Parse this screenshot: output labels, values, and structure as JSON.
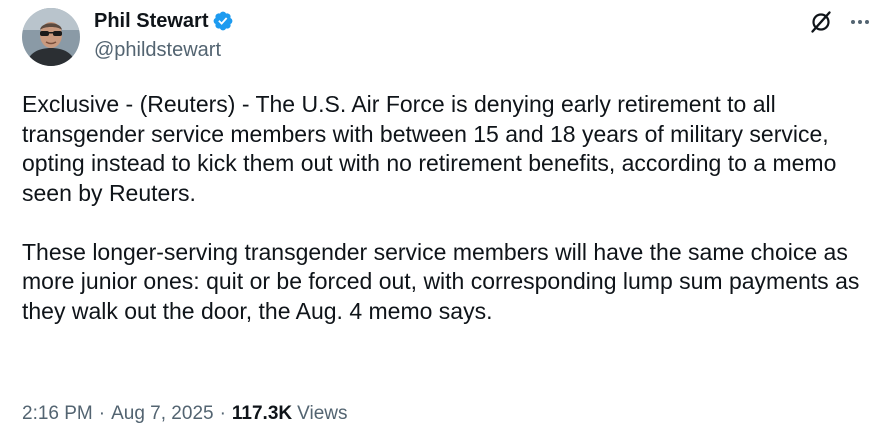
{
  "author": {
    "display_name": "Phil Stewart",
    "handle": "@phildstewart",
    "verified": true,
    "verified_color": "#1d9bf0"
  },
  "tweet": {
    "paragraphs": [
      "Exclusive - (Reuters) - The U.S. Air Force is denying early retirement to all transgender service members with between 15 and 18 years of military service, opting instead to kick them out with no retirement benefits, according to a memo seen by Reuters.",
      "These longer-serving transgender service members will have the same choice as more junior ones: quit or be forced out, with corresponding lump sum payments as they walk out the door, the Aug. 4 memo says."
    ]
  },
  "meta": {
    "time": "2:16 PM",
    "separator": "·",
    "date": "Aug 7, 2025",
    "views_count": "117.3K",
    "views_label": "Views"
  },
  "icons": {
    "grok": "grok-icon",
    "more": "more-options-icon",
    "verified": "verified-badge-icon"
  },
  "colors": {
    "text_primary": "#0f1419",
    "text_secondary": "#536471",
    "accent": "#1d9bf0"
  }
}
